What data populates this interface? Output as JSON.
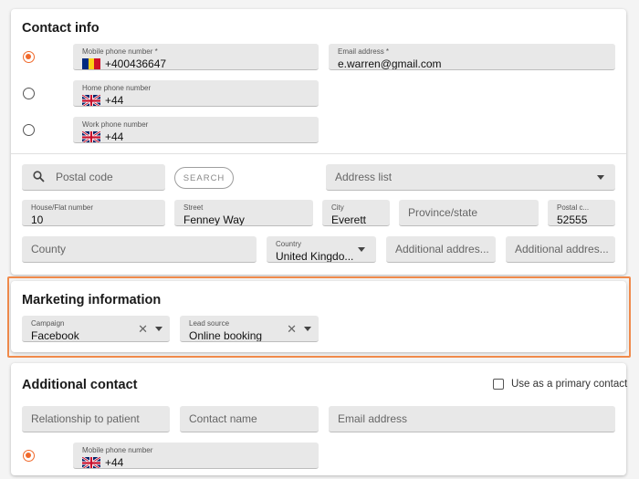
{
  "contact_info": {
    "title": "Contact info",
    "mobile": {
      "label": "Mobile phone number *",
      "value": "+400436647",
      "flag": "romania-flag-icon",
      "selected": true
    },
    "email": {
      "label": "Email address *",
      "value": "e.warren@gmail.com"
    },
    "home": {
      "label": "Home phone number",
      "value": "+44",
      "flag": "uk-flag-icon",
      "selected": false
    },
    "work": {
      "label": "Work phone number",
      "value": "+44",
      "flag": "uk-flag-icon",
      "selected": false
    }
  },
  "address": {
    "postal_search_placeholder": "Postal code",
    "search_button": "SEARCH",
    "address_list_placeholder": "Address list",
    "house": {
      "label": "House/Flat number",
      "value": "10"
    },
    "street": {
      "label": "Street",
      "value": "Fenney Way"
    },
    "city": {
      "label": "City",
      "value": "Everett"
    },
    "province_placeholder": "Province/state",
    "postal": {
      "label": "Postal c...",
      "value": "52555"
    },
    "county_placeholder": "County",
    "country": {
      "label": "Country",
      "value": "United Kingdo..."
    },
    "additional1_placeholder": "Additional addres...",
    "additional2_placeholder": "Additional addres..."
  },
  "marketing": {
    "title": "Marketing information",
    "campaign": {
      "label": "Campaign",
      "value": "Facebook"
    },
    "lead_source": {
      "label": "Lead source",
      "value": "Online booking"
    }
  },
  "additional_contact": {
    "title": "Additional contact",
    "primary_label": "Use as a primary contact",
    "relationship_placeholder": "Relationship to patient",
    "contact_name_placeholder": "Contact name",
    "email_placeholder": "Email address",
    "mobile": {
      "label": "Mobile phone number",
      "value": "+44",
      "flag": "uk-flag-icon",
      "selected": true
    }
  },
  "colors": {
    "accent": "#f0692b",
    "highlight": "#f08a4b",
    "field_bg": "#e8e8e8"
  }
}
